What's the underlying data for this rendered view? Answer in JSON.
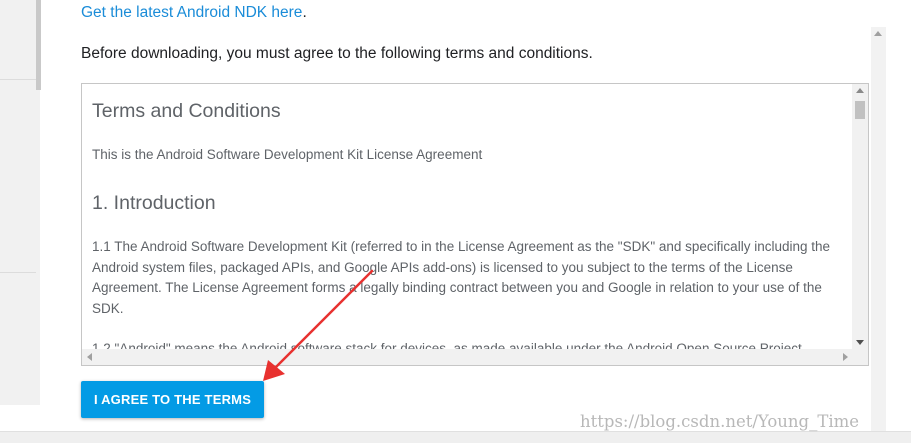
{
  "header": {
    "ndk_link_text": "Get the latest Android NDK here",
    "ndk_link_suffix": ".",
    "intro": "Before downloading, you must agree to the following terms and conditions."
  },
  "terms": {
    "title": "Terms and Conditions",
    "subtitle": "This is the Android Software Development Kit License Agreement",
    "section_heading": "1. Introduction",
    "para_1": "1.1 The Android Software Development Kit (referred to in the License Agreement as the \"SDK\" and specifically including the Android system files, packaged APIs, and Google APIs add-ons) is licensed to you subject to the terms of the License Agreement. The License Agreement forms a legally binding contract between you and Google in relation to your use of the SDK.",
    "para_2": "1.2 \"Android\" means the Android software stack for devices, as made available under the Android Open Source Project"
  },
  "actions": {
    "agree_label": "I AGREE TO THE TERMS"
  },
  "watermark": "https://blog.csdn.net/Young_Time",
  "colors": {
    "link": "#1a8cd8",
    "button": "#039be5",
    "annotation_arrow": "#e8312f"
  },
  "icons": {
    "scroll_up": "scroll-up-arrow-icon",
    "scroll_down": "scroll-down-arrow-icon",
    "scroll_left": "scroll-left-arrow-icon",
    "scroll_right": "scroll-right-arrow-icon",
    "annotation": "red-annotation-arrow-icon"
  }
}
